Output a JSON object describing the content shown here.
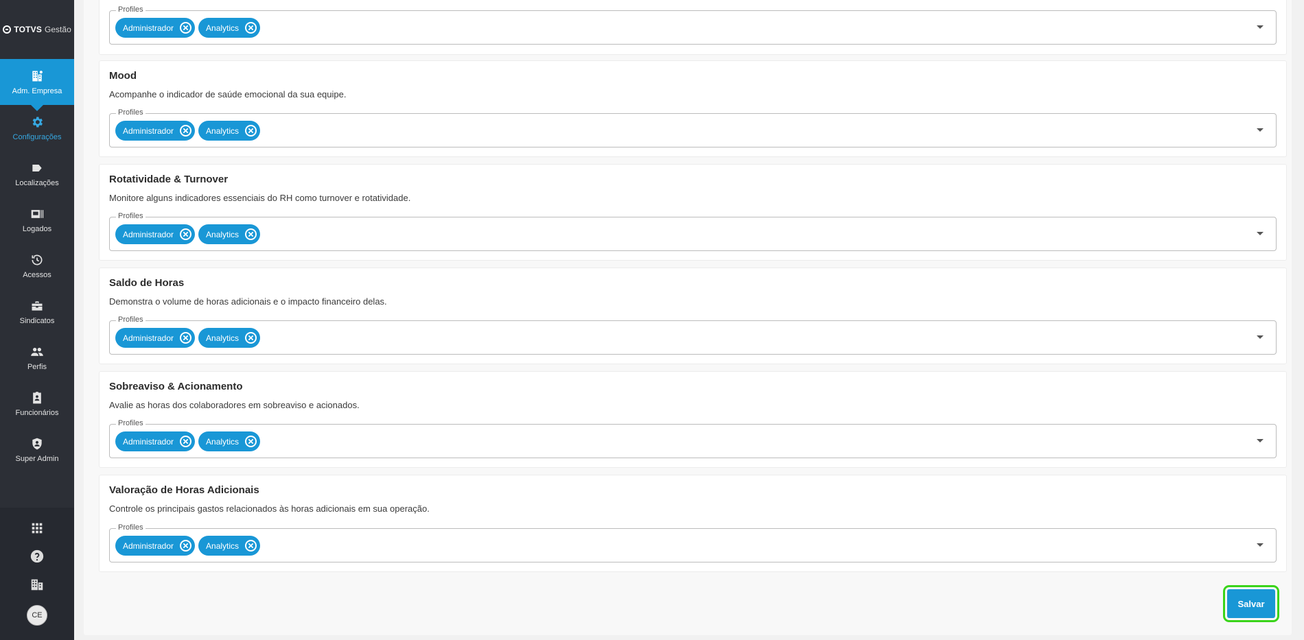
{
  "brand": {
    "name": "TOTVS",
    "sub": "Gestão"
  },
  "nav": [
    {
      "label": "Adm. Empresa",
      "icon": "building-icon"
    },
    {
      "label": "Configurações",
      "icon": "gear-icon"
    },
    {
      "label": "Localizações",
      "icon": "tag-icon"
    },
    {
      "label": "Logados",
      "icon": "id-card-icon"
    },
    {
      "label": "Acessos",
      "icon": "history-icon"
    },
    {
      "label": "Sindicatos",
      "icon": "briefcase-icon"
    },
    {
      "label": "Perfis",
      "icon": "people-icon"
    },
    {
      "label": "Funcionários",
      "icon": "badge-icon"
    },
    {
      "label": "Super Admin",
      "icon": "shield-user-icon"
    }
  ],
  "user": {
    "initials": "CE"
  },
  "field_label": "Profiles",
  "cards": [
    {
      "title": "",
      "description": "",
      "chips": [
        "Administrador",
        "Analytics"
      ]
    },
    {
      "title": "Mood",
      "description": "Acompanhe o indicador de saúde emocional da sua equipe.",
      "chips": [
        "Administrador",
        "Analytics"
      ]
    },
    {
      "title": "Rotatividade & Turnover",
      "description": "Monitore alguns indicadores essenciais do RH como turnover e rotatividade.",
      "chips": [
        "Administrador",
        "Analytics"
      ]
    },
    {
      "title": "Saldo de Horas",
      "description": "Demonstra o volume de horas adicionais e o impacto financeiro delas.",
      "chips": [
        "Administrador",
        "Analytics"
      ]
    },
    {
      "title": "Sobreaviso & Acionamento",
      "description": "Avalie as horas dos colaboradores em sobreaviso e acionados.",
      "chips": [
        "Administrador",
        "Analytics"
      ]
    },
    {
      "title": "Valoração de Horas Adicionais",
      "description": "Controle os principais gastos relacionados às horas adicionais em sua operação.",
      "chips": [
        "Administrador",
        "Analytics"
      ]
    }
  ],
  "save_label": "Salvar",
  "colors": {
    "accent": "#1997d6",
    "sidebar": "#2c2f36",
    "highlight": "#3ad41a"
  }
}
